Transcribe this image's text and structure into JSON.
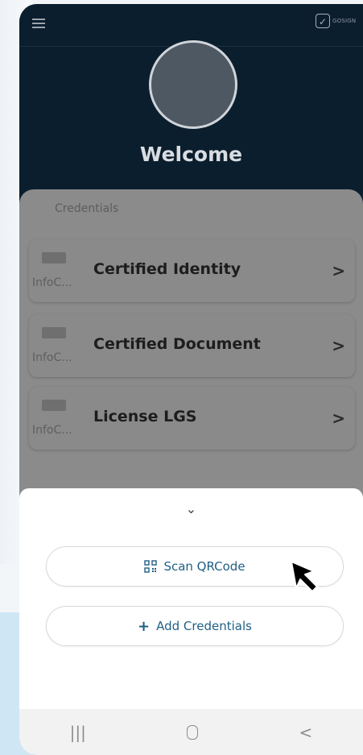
{
  "header": {
    "logo_text": "GOSIGN",
    "welcome": "Welcome"
  },
  "credentials": {
    "section_label": "Credentials",
    "items": [
      {
        "org": "InfoC...",
        "title": "Certified Identity",
        "chevron": ">"
      },
      {
        "org": "InfoC...",
        "title": "Certified Document",
        "chevron": ">"
      },
      {
        "org": "InfoC...",
        "title": "License LGS",
        "chevron": ">"
      }
    ]
  },
  "sheet": {
    "collapse_glyph": "⌄",
    "scan_label": "Scan QRCode",
    "add_label": "Add Credentials",
    "add_glyph": "+"
  },
  "nav": {
    "recents_glyph": "|||",
    "back_glyph": "<"
  },
  "colors": {
    "header_bg": "#0b1e2e",
    "accent": "#1f5f86",
    "sheet_bg": "#ffffff"
  }
}
